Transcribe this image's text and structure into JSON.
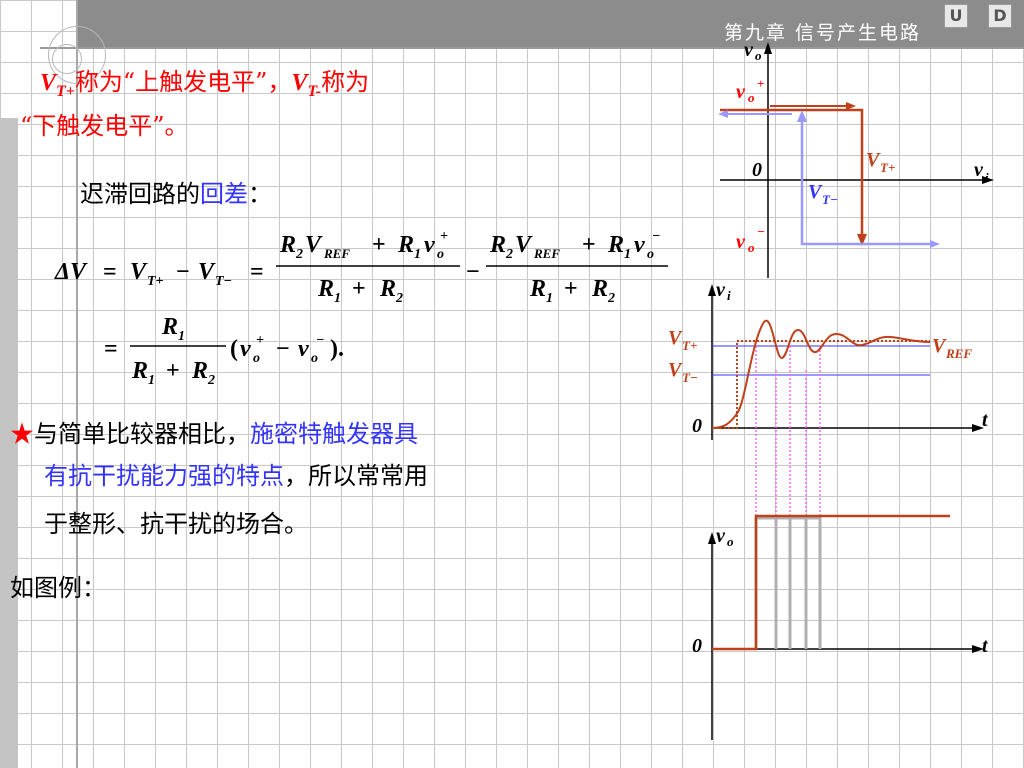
{
  "header": {
    "chapter": "第九章  信号产生电路",
    "nav_u": "U",
    "nav_d": "D"
  },
  "text": {
    "line1_vt_plus_v": "V",
    "line1_vt_plus_sub": "T+",
    "line1_mid": "称为“上触发电平”，",
    "line1_vt_minus_v": "V",
    "line1_vt_minus_sub": "T-",
    "line1_end": "称为",
    "line2": "“下触发电平”。",
    "hyst_label": "迟滞回路的",
    "hyst_highlight": "回差",
    "hyst_colon": "：",
    "star": "★",
    "compare_p1": "与简单比较器相比，",
    "compare_p2_blue": "施密特触发器具",
    "compare_p3_blue": "有抗干扰能力强的特点",
    "compare_p3_black": "，所以常常用",
    "compare_p4": "于整形、抗干扰的场合。",
    "example": "如图例："
  },
  "formula": {
    "delta_v": "ΔV",
    "eq": "=",
    "vt": "V",
    "sub_tplus": "T+",
    "sub_tminus": "T−",
    "minus": "−",
    "num1_r2": "R",
    "sub2": "2",
    "sub1": "1",
    "vref_v": "V",
    "sub_ref": "REF",
    "plus": "+",
    "num_r1": "R",
    "vo": "v",
    "sub_o": "o",
    "sup_plus": "+",
    "sup_minus": "−",
    "den_r": "R",
    "line2_num": "R",
    "paren_open": "(",
    "paren_close": ").",
    "dot": "."
  },
  "hysteresis_graph": {
    "y_axis": "v",
    "y_axis_sub": "o",
    "x_axis": "v",
    "x_axis_sub": "i",
    "origin": "0",
    "vo_plus": "v",
    "vo_plus_sub": "o",
    "vo_plus_sup": "+",
    "vo_minus": "v",
    "vo_minus_sub": "o",
    "vo_minus_sup": "−",
    "vt_plus": "V",
    "vt_plus_sub": "T+",
    "vt_minus": "V",
    "vt_minus_sub": "T−"
  },
  "input_graph": {
    "y_axis": "v",
    "y_axis_sub": "i",
    "x_axis": "t",
    "origin": "0",
    "vt_plus": "V",
    "vt_plus_sub": "T+",
    "vt_minus": "V",
    "vt_minus_sub": "T−",
    "vref": "V",
    "vref_sub": "REF"
  },
  "output_graph": {
    "y_axis": "v",
    "y_axis_sub": "o",
    "x_axis": "t",
    "origin": "0"
  },
  "colors": {
    "red": "#ff0000",
    "blue": "#3333ff",
    "curve": "#c0401a",
    "loop_red": "#c0401a",
    "loop_blue": "#9999ff",
    "magenta": "#ff66ff",
    "gray": "#b0b0b0"
  }
}
